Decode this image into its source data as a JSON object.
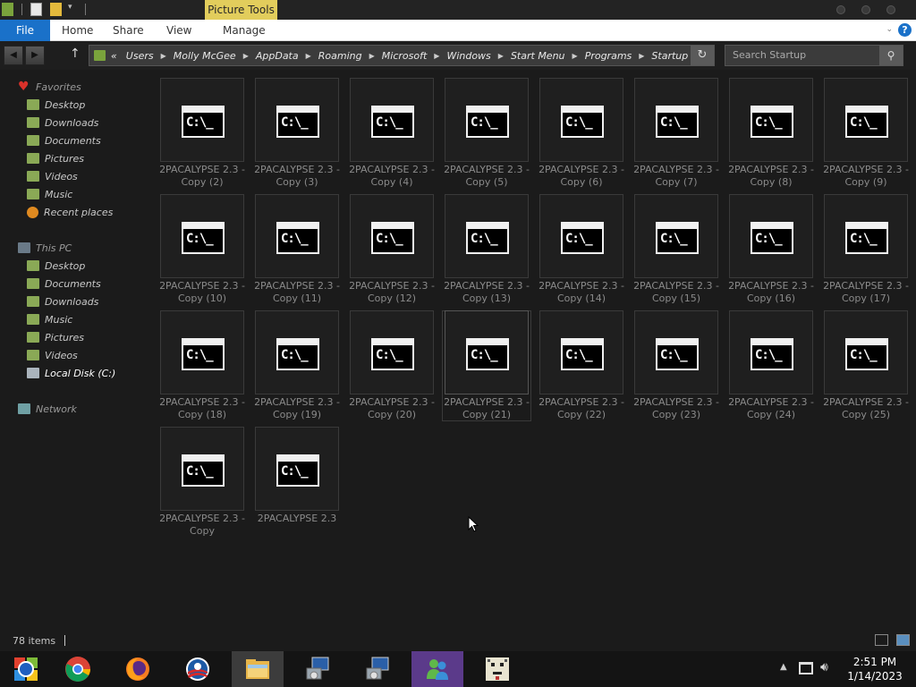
{
  "titlebar": {
    "context_tab": "Picture Tools"
  },
  "ribbon": {
    "file": "File",
    "home": "Home",
    "share": "Share",
    "view": "View",
    "manage": "Manage",
    "help": "?"
  },
  "address": {
    "crumbs": [
      "«",
      "Users",
      "Molly McGee",
      "AppData",
      "Roaming",
      "Microsoft",
      "Windows",
      "Start Menu",
      "Programs",
      "Startup"
    ],
    "search_placeholder": "Search Startup"
  },
  "sidebar": {
    "favorites": "Favorites",
    "fav_items": [
      "Desktop",
      "Downloads",
      "Documents",
      "Pictures",
      "Videos",
      "Music",
      "Recent places"
    ],
    "this_pc": "This PC",
    "pc_items": [
      "Desktop",
      "Documents",
      "Downloads",
      "Music",
      "Pictures",
      "Videos",
      "Local Disk (C:)"
    ],
    "network": "Network"
  },
  "files": [
    [
      "2PACALYPSE 2.3 -",
      "Copy (2)"
    ],
    [
      "2PACALYPSE 2.3 -",
      "Copy (3)"
    ],
    [
      "2PACALYPSE 2.3 -",
      "Copy (4)"
    ],
    [
      "2PACALYPSE 2.3 -",
      "Copy (5)"
    ],
    [
      "2PACALYPSE 2.3 -",
      "Copy (6)"
    ],
    [
      "2PACALYPSE 2.3 -",
      "Copy (7)"
    ],
    [
      "2PACALYPSE 2.3 -",
      "Copy (8)"
    ],
    [
      "2PACALYPSE 2.3 -",
      "Copy (9)"
    ],
    [
      "2PACALYPSE 2.3 -",
      "Copy (10)"
    ],
    [
      "2PACALYPSE 2.3 -",
      "Copy (11)"
    ],
    [
      "2PACALYPSE 2.3 -",
      "Copy (12)"
    ],
    [
      "2PACALYPSE 2.3 -",
      "Copy (13)"
    ],
    [
      "2PACALYPSE 2.3 -",
      "Copy (14)"
    ],
    [
      "2PACALYPSE 2.3 -",
      "Copy (15)"
    ],
    [
      "2PACALYPSE 2.3 -",
      "Copy (16)"
    ],
    [
      "2PACALYPSE 2.3 -",
      "Copy (17)"
    ],
    [
      "2PACALYPSE 2.3 -",
      "Copy (18)"
    ],
    [
      "2PACALYPSE 2.3 -",
      "Copy (19)"
    ],
    [
      "2PACALYPSE 2.3 -",
      "Copy (20)"
    ],
    [
      "2PACALYPSE 2.3 -",
      "Copy (21)"
    ],
    [
      "2PACALYPSE 2.3 -",
      "Copy (22)"
    ],
    [
      "2PACALYPSE 2.3 -",
      "Copy (23)"
    ],
    [
      "2PACALYPSE 2.3 -",
      "Copy (24)"
    ],
    [
      "2PACALYPSE 2.3 -",
      "Copy (25)"
    ],
    [
      "2PACALYPSE 2.3 -",
      "Copy"
    ],
    [
      "2PACALYPSE 2.3",
      ""
    ]
  ],
  "file_icon_text": "C:\\_",
  "status": {
    "count": "78 items"
  },
  "clock": {
    "time": "2:51 PM",
    "date": "1/14/2023"
  },
  "colors": {
    "accent": "#1a71c9",
    "context_tab": "#e2cd5c",
    "background": "#1b1b1b"
  }
}
